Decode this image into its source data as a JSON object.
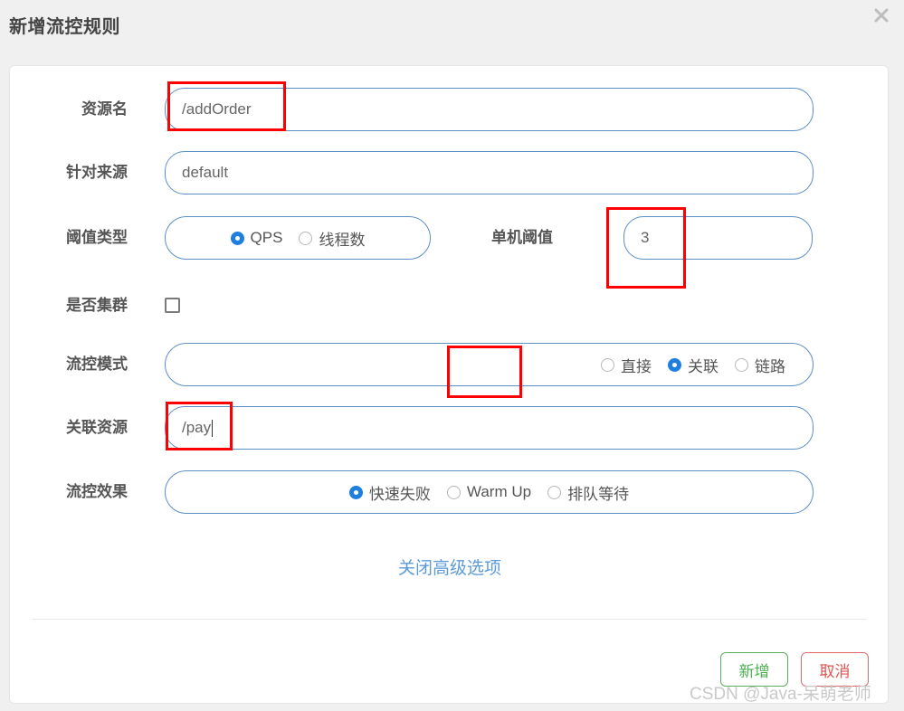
{
  "header": {
    "title": "新增流控规则",
    "close_icon": "close-icon"
  },
  "form": {
    "resource_name": {
      "label": "资源名",
      "value": "/addOrder"
    },
    "limit_app": {
      "label": "针对来源",
      "value": "default"
    },
    "threshold_type": {
      "label": "阈值类型",
      "options": [
        {
          "label": "QPS",
          "checked": true
        },
        {
          "label": "线程数",
          "checked": false
        }
      ]
    },
    "single_threshold": {
      "label": "单机阈值",
      "value": "3"
    },
    "is_cluster": {
      "label": "是否集群",
      "checked": false
    },
    "flow_mode": {
      "label": "流控模式",
      "options": [
        {
          "label": "直接",
          "checked": false
        },
        {
          "label": "关联",
          "checked": true
        },
        {
          "label": "链路",
          "checked": false
        }
      ]
    },
    "ref_resource": {
      "label": "关联资源",
      "value": "/pay"
    },
    "flow_effect": {
      "label": "流控效果",
      "options": [
        {
          "label": "快速失败",
          "checked": true
        },
        {
          "label": "Warm Up",
          "checked": false
        },
        {
          "label": "排队等待",
          "checked": false
        }
      ]
    }
  },
  "advanced_toggle": {
    "label": "关闭高级选项"
  },
  "footer": {
    "add_label": "新增",
    "cancel_label": "取消"
  },
  "watermark": {
    "text": "CSDN @Java-呆萌老师"
  },
  "colors": {
    "accent": "#5b8fc7",
    "radio_checked": "#1f7fe0",
    "link": "#5a9bd8",
    "add_button": "#4caf50",
    "cancel_button": "#e2524f",
    "annotation": "#ff0000"
  }
}
